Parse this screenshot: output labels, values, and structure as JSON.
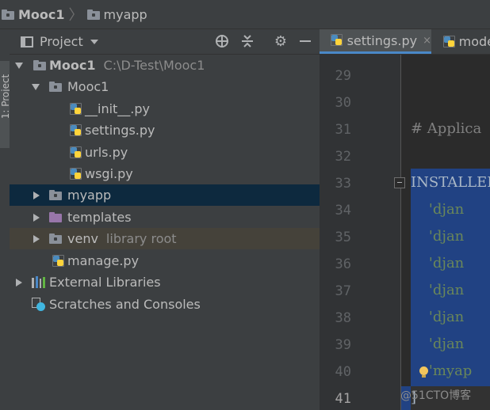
{
  "breadcrumb": {
    "project": "Mooc1",
    "folder": "myapp"
  },
  "side_strip": {
    "label": "1: Project"
  },
  "project_panel": {
    "title": "Project",
    "icons": [
      "target-icon",
      "collapse-icon",
      "gear-icon",
      "minimize-icon"
    ],
    "tree": [
      {
        "label": "Mooc1",
        "hint": "C:\\D-Test\\Mooc1",
        "icon": "folder-icon",
        "expanded": true
      },
      {
        "label": "Mooc1",
        "icon": "folder-icon",
        "expanded": true
      },
      {
        "label": "__init__.py",
        "icon": "python-file-icon"
      },
      {
        "label": "settings.py",
        "icon": "python-file-icon"
      },
      {
        "label": "urls.py",
        "icon": "python-file-icon"
      },
      {
        "label": "wsgi.py",
        "icon": "python-file-icon"
      },
      {
        "label": "myapp",
        "icon": "folder-icon",
        "expanded": false,
        "selected": true
      },
      {
        "label": "templates",
        "icon": "purple-folder-icon",
        "expanded": false
      },
      {
        "label": "venv",
        "hint": "library root",
        "icon": "folder-icon",
        "expanded": false
      },
      {
        "label": "manage.py",
        "icon": "python-file-icon"
      },
      {
        "label": "External Libraries",
        "icon": "libraries-icon",
        "expanded": false
      },
      {
        "label": "Scratches and Consoles",
        "icon": "scratches-icon"
      }
    ]
  },
  "editor": {
    "tabs": [
      {
        "label": "settings.py",
        "close": "×",
        "active": true
      },
      {
        "label": "mode",
        "active": false
      }
    ],
    "line_numbers": [
      "29",
      "30",
      "31",
      "32",
      "33",
      "34",
      "35",
      "36",
      "37",
      "38",
      "39",
      "40",
      "41"
    ],
    "current_line": "41",
    "code": [
      {
        "text": "",
        "kind": "ident"
      },
      {
        "text": "",
        "kind": "ident"
      },
      {
        "text": "# Applica",
        "kind": "comment"
      },
      {
        "text": "",
        "kind": "ident"
      },
      {
        "text": "INSTALLED",
        "kind": "ident"
      },
      {
        "text": "    'djan",
        "kind": "str"
      },
      {
        "text": "    'djan",
        "kind": "str"
      },
      {
        "text": "    'djan",
        "kind": "str"
      },
      {
        "text": "    'djan",
        "kind": "str"
      },
      {
        "text": "    'djan",
        "kind": "str"
      },
      {
        "text": "    'djan",
        "kind": "str"
      },
      {
        "text": "    'myap",
        "kind": "str"
      },
      {
        "text": "]",
        "kind": "ident"
      }
    ]
  },
  "watermark": "@51CTO博客",
  "colors": {
    "selection": "#214283",
    "selected_row": "#0D293E",
    "accent": "#4A88C7"
  }
}
